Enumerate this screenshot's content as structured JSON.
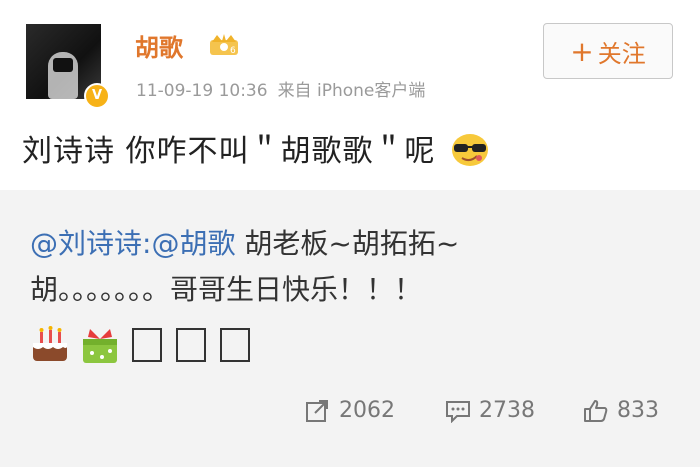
{
  "user": {
    "name": "胡歌",
    "verified_badge": "V"
  },
  "meta": {
    "timestamp": "11-09-19 10:36",
    "source": "来自 iPhone客户端"
  },
  "follow_button": {
    "label": "关注",
    "plus": "+"
  },
  "post_text": "刘诗诗 你咋不叫＂胡歌歌＂呢",
  "repost": {
    "mention1": "@刘诗诗",
    "mention2": ":@胡歌",
    "line1_rest": " 胡老板~胡拓拓~",
    "line2": "胡。。。。。。。哥哥生日快乐！！！"
  },
  "actions": {
    "repost_count": "2062",
    "comment_count": "2738",
    "like_count": "833"
  },
  "colors": {
    "name": "#e0772c",
    "link": "#3c6fb4",
    "meta": "#9a9a9a"
  },
  "icons": [
    "crown-icon",
    "sunglasses-emoji-icon",
    "cake-emoji-icon",
    "gift-emoji-icon",
    "repost-icon",
    "comment-icon",
    "like-icon"
  ]
}
